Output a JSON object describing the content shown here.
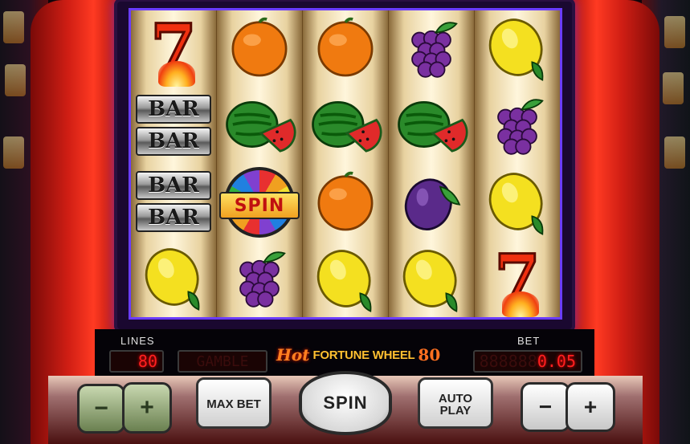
{
  "game": {
    "logo": {
      "hot": "Hot",
      "name": "FORTUNE WHEEL",
      "number": "80"
    }
  },
  "reels": [
    [
      "seven",
      "bar-double",
      "bar-double",
      "lemon"
    ],
    [
      "orange",
      "watermelon",
      "spin",
      "grapes"
    ],
    [
      "orange",
      "watermelon",
      "orange",
      "lemon"
    ],
    [
      "grapes",
      "watermelon",
      "plum",
      "lemon"
    ],
    [
      "lemon",
      "grapes",
      "lemon",
      "seven"
    ]
  ],
  "symbols": {
    "bar_label": "BAR",
    "spin_label": "SPIN"
  },
  "panel": {
    "lines_label": "LINES",
    "lines_value": "80",
    "gamble_label": "GAMBLE",
    "bet_label": "BET",
    "bet_ghost": "888888",
    "bet_value": "0.05"
  },
  "buttons": {
    "lines_minus": "−",
    "lines_plus": "+",
    "max_bet": "MAX BET",
    "spin": "SPIN",
    "auto_play": "AUTO PLAY",
    "bet_minus": "−",
    "bet_plus": "+"
  },
  "colors": {
    "frame_red": "#d01e14",
    "screen_border": "#6a3cff",
    "led_red": "#ff2020",
    "lemon": "#f4e020",
    "orange": "#f07a10",
    "grape": "#7a30a0",
    "plum": "#5a2a8a",
    "watermelon_rind": "#2a8a2a",
    "watermelon_flesh": "#e02a2a"
  }
}
